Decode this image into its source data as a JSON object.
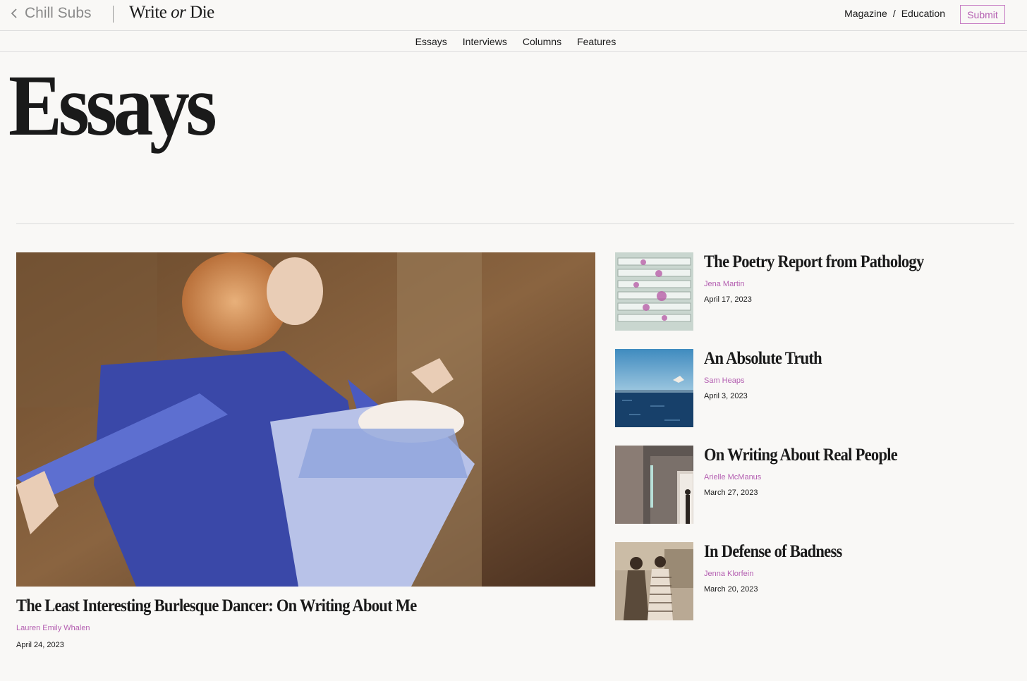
{
  "header": {
    "back_label": "Chill Subs",
    "brand_part1": "Write",
    "brand_part2": "or",
    "brand_part3": "Die",
    "nav": [
      "Magazine",
      "Education"
    ],
    "nav_separator": "/",
    "submit_label": "Submit"
  },
  "subnav": [
    "Essays",
    "Interviews",
    "Columns",
    "Features"
  ],
  "page_title": "Essays",
  "featured": {
    "title": "The Least Interesting Burlesque Dancer: On Writing About Me",
    "author": "Lauren Emily Whalen",
    "date": "April 24, 2023"
  },
  "articles": [
    {
      "title": "The Poetry Report from Pathology",
      "author": "Jena Martin",
      "date": "April 17, 2023"
    },
    {
      "title": "An Absolute Truth",
      "author": "Sam Heaps",
      "date": "April 3, 2023"
    },
    {
      "title": "On Writing About Real People",
      "author": "Arielle McManus",
      "date": "March 27, 2023"
    },
    {
      "title": "In Defense of Badness",
      "author": "Jenna Klorfein",
      "date": "March 20, 2023"
    }
  ],
  "colors": {
    "background": "#f9f8f6",
    "accent": "#b45fb1",
    "text": "#1a1a1a",
    "muted": "#8a8a8a",
    "rule": "#dcdcdc"
  },
  "icons": {
    "back": "chevron-left-icon"
  }
}
